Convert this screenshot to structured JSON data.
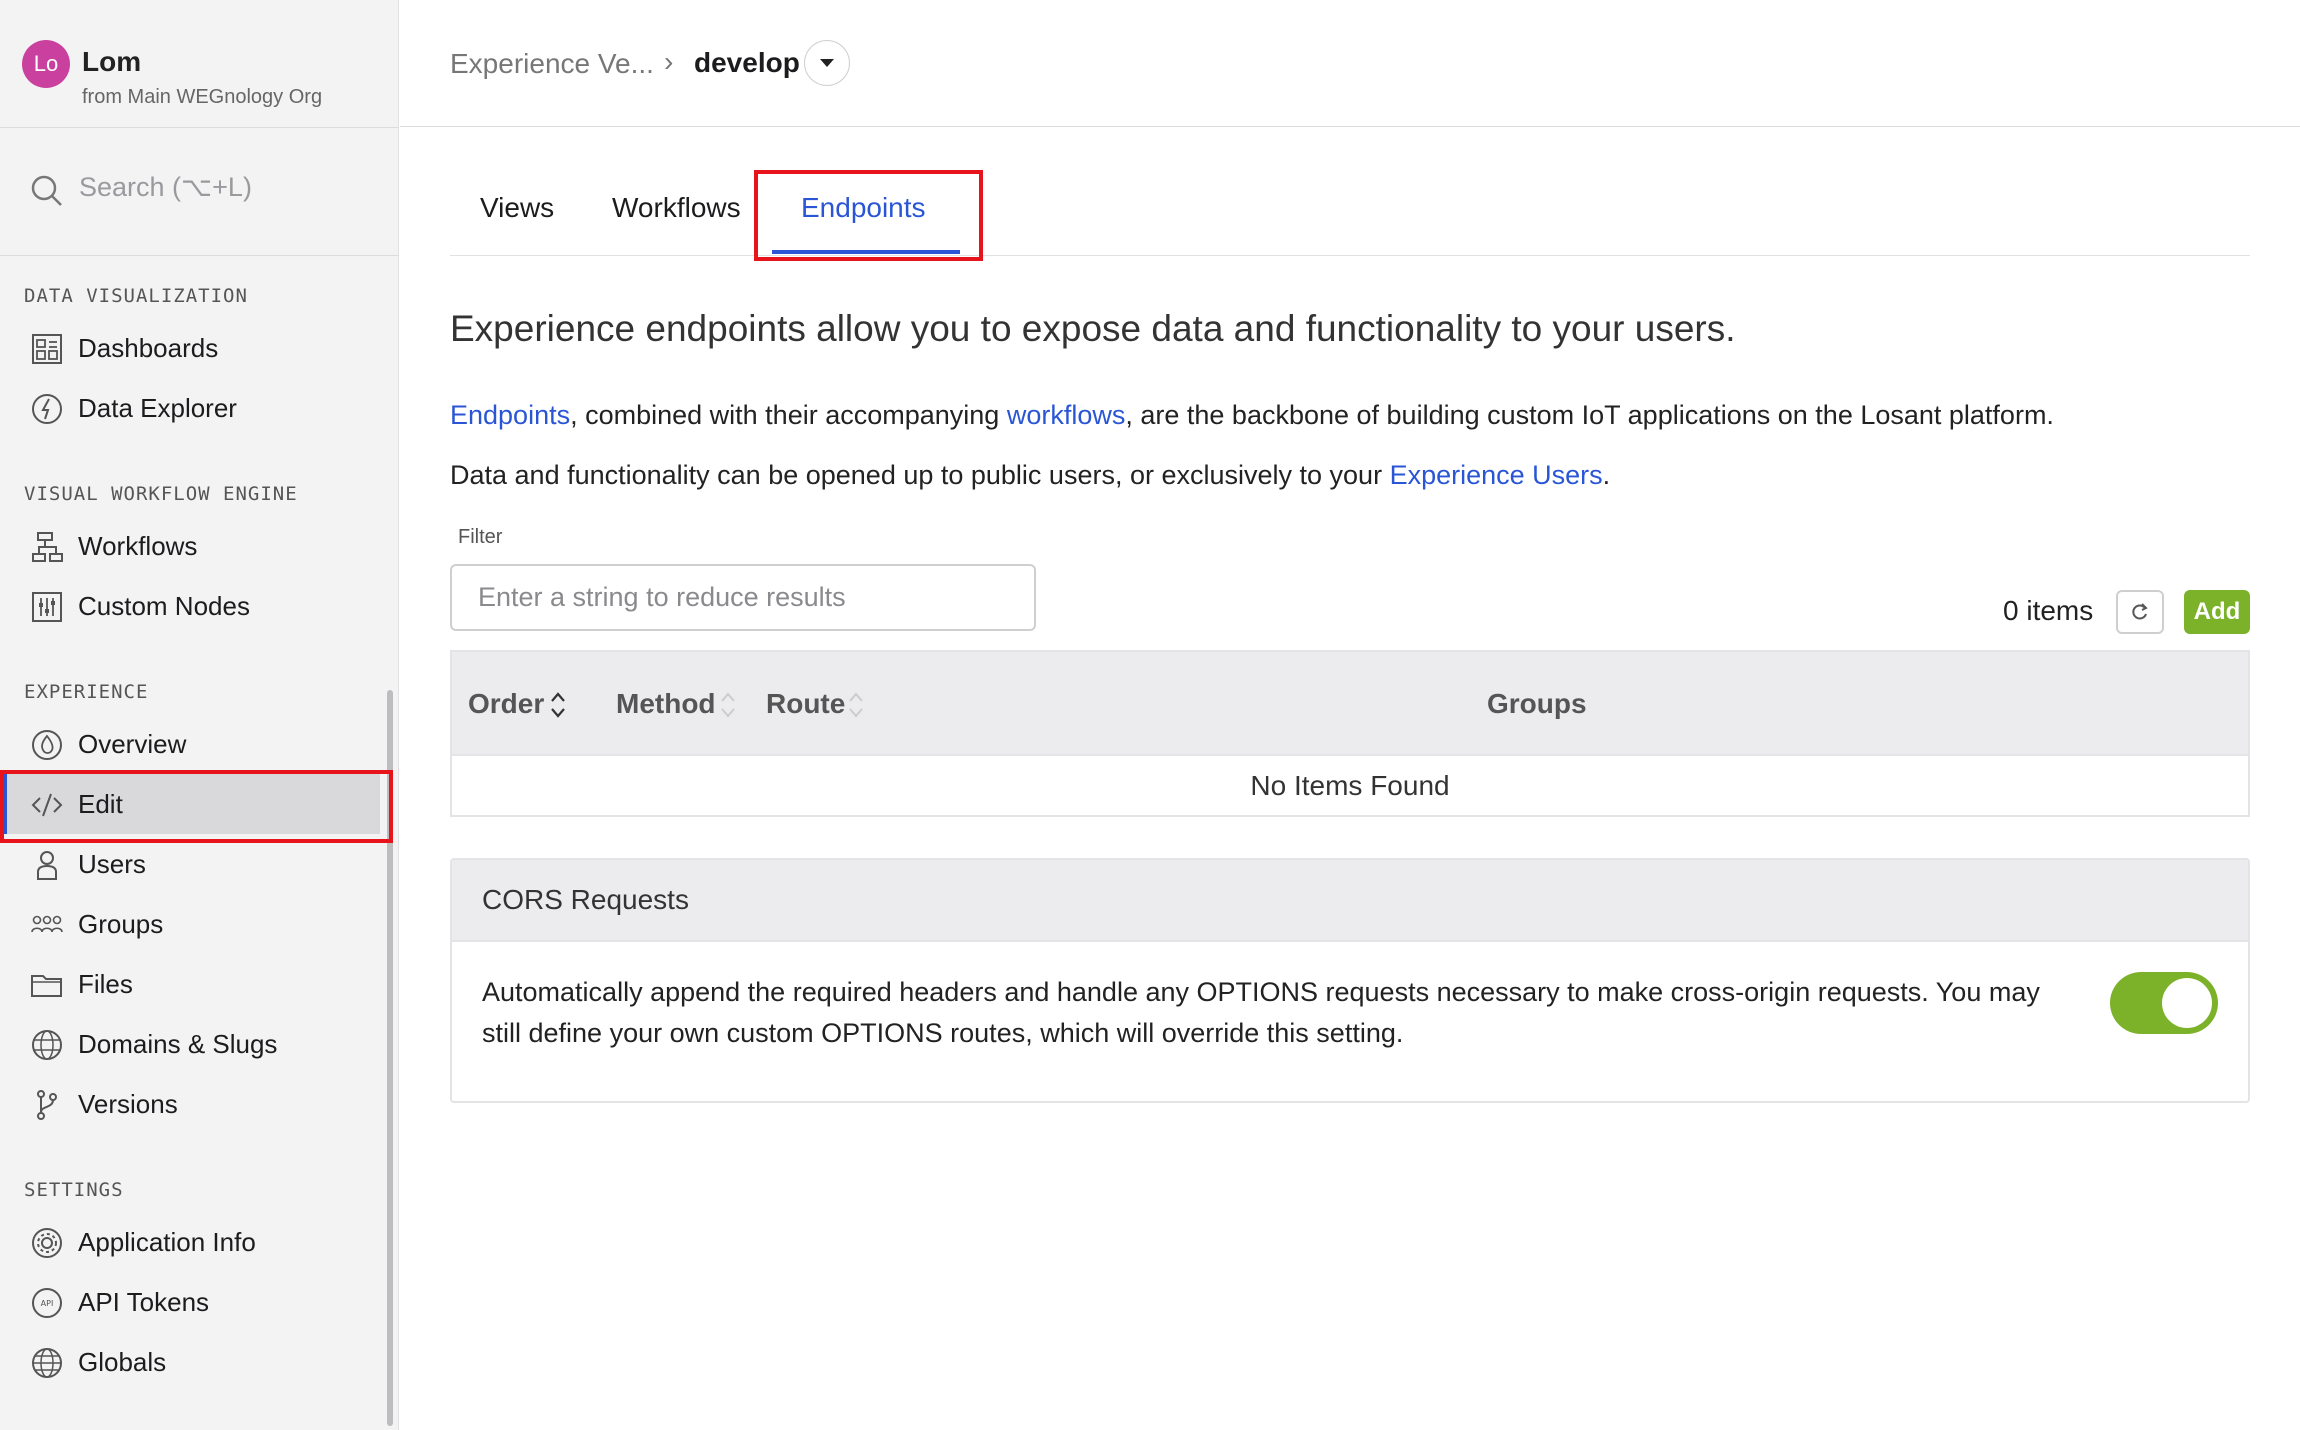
{
  "org": {
    "avatar_initials": "Lo",
    "name": "Lom",
    "subtitle": "from Main WEGnology Org"
  },
  "search": {
    "placeholder": "Search (⌥+L)"
  },
  "sidebar": {
    "sections": {
      "data_viz": "DATA VISUALIZATION",
      "workflow_engine": "VISUAL WORKFLOW ENGINE",
      "experience": "EXPERIENCE",
      "settings": "SETTINGS"
    },
    "items": {
      "dashboards": "Dashboards",
      "data_explorer": "Data Explorer",
      "workflows": "Workflows",
      "custom_nodes": "Custom Nodes",
      "overview": "Overview",
      "edit": "Edit",
      "users": "Users",
      "groups": "Groups",
      "files": "Files",
      "domains": "Domains & Slugs",
      "versions": "Versions",
      "app_info": "Application Info",
      "api_tokens": "API Tokens",
      "globals": "Globals"
    }
  },
  "breadcrumb": {
    "parent": "Experience Ve...",
    "separator": "›",
    "current": "develop"
  },
  "tabs": {
    "views": "Views",
    "workflows": "Workflows",
    "endpoints": "Endpoints"
  },
  "content": {
    "heading": "Experience endpoints allow you to expose data and functionality to your users.",
    "p1_link1": "Endpoints",
    "p1_mid": ", combined with their accompanying ",
    "p1_link2": "workflows",
    "p1_end": ", are the backbone of building custom IoT applications on the Losant platform.",
    "p2_start": "Data and functionality can be opened up to public users, or exclusively to your ",
    "p2_link": "Experience Users",
    "p2_end": "."
  },
  "filter": {
    "label": "Filter",
    "placeholder": "Enter a string to reduce results",
    "value": ""
  },
  "toolbar": {
    "items_count": "0 items",
    "add_label": "Add"
  },
  "table": {
    "columns": {
      "order": "Order",
      "method": "Method",
      "route": "Route",
      "groups": "Groups"
    },
    "empty": "No Items Found"
  },
  "cors": {
    "title": "CORS Requests",
    "description": "Automatically append the required headers and handle any OPTIONS requests necessary to make cross-origin requests. You may still define your own custom OPTIONS routes, which will override this setting.",
    "enabled": true
  },
  "colors": {
    "accent": "#2a56d6",
    "success": "#7cb22a",
    "highlight": "#e8141b"
  }
}
